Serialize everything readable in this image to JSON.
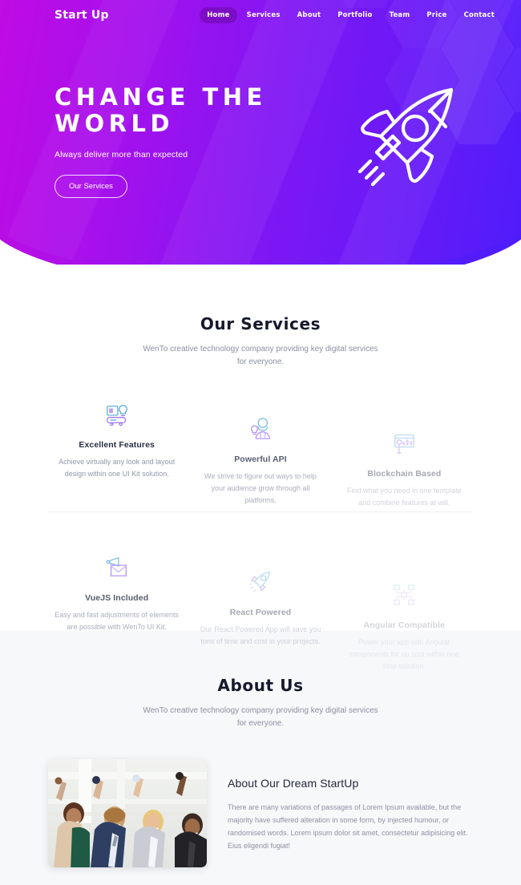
{
  "nav": {
    "logo": "Start Up",
    "links": [
      {
        "label": "Home",
        "active": true
      },
      {
        "label": "Services",
        "active": false
      },
      {
        "label": "About",
        "active": false
      },
      {
        "label": "Portfolio",
        "active": false
      },
      {
        "label": "Team",
        "active": false
      },
      {
        "label": "Price",
        "active": false
      },
      {
        "label": "Contact",
        "active": false
      }
    ]
  },
  "hero": {
    "title": "CHANGE THE\nWORLD",
    "subtitle": "Always deliver more than expected",
    "button_label": "Our Services",
    "illustration": "rocket-icon",
    "gradient_start": "#bd09e0",
    "gradient_end": "#4a1cfb"
  },
  "services": {
    "title": "Our Services",
    "subtitle": "WenTo creative technology company providing key digital services for everyone.",
    "cards": [
      {
        "icon": "ui-kit-icon",
        "title": "Excellent Features",
        "desc": "Achieve virtually any look and layout design within one UI Kit solution."
      },
      {
        "icon": "api-person-icon",
        "title": "Powerful API",
        "desc": "We strive to figure out ways to help your audience grow through all platforms."
      },
      {
        "icon": "blockchain-chart-icon",
        "title": "Blockchain Based",
        "desc": "Find what you need in one template and combine features at will."
      },
      {
        "icon": "envelope-megaphone-icon",
        "title": "VueJS Included",
        "desc": "Easy and fast adjustments of elements are possible with WenTo UI Kit."
      },
      {
        "icon": "react-rocket-icon",
        "title": "React Powered",
        "desc": "Our React Powered App will save you tons of time and cost in your projects."
      },
      {
        "icon": "angular-network-icon",
        "title": "Angular Compatible",
        "desc": "Power your app with Angular components for no cost within one stop solution."
      }
    ]
  },
  "about": {
    "title": "About Us",
    "subtitle": "WenTo creative technology company providing key digital services for everyone.",
    "photo_alt": "team-celebrating-photo",
    "heading": "About Our Dream StartUp",
    "paragraph": "There are many variations of passages of Lorem Ipsum available, but the majority have suffered alteration in some form, by injected humour, or randomised words. Lorem ipsum dolor sit amet, consectetur adipisicing elit. Eius eligendi fugiat!"
  }
}
